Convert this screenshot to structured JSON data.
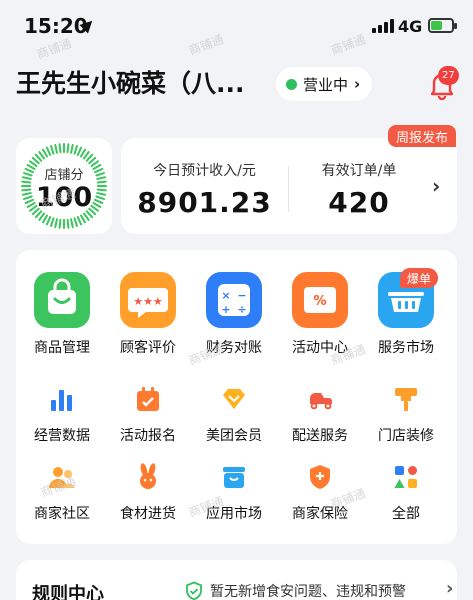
{
  "status_bar": {
    "time": "15:20",
    "network": "4G",
    "battery_level": 0.55
  },
  "header": {
    "store_name": "王先生小碗菜（八...",
    "status": "营业中",
    "notification_count": "27"
  },
  "score": {
    "label": "店铺分",
    "value": "100"
  },
  "stats": {
    "tag": "周报发布",
    "income_label": "今日预计收入/元",
    "income_value": "8901.23",
    "orders_label": "有效订单/单",
    "orders_value": "420"
  },
  "grid": {
    "hot_tag": "爆单",
    "big": [
      {
        "label": "商品管理",
        "icon": "shopping-bag-icon",
        "color": "#3cc45e"
      },
      {
        "label": "顾客评价",
        "icon": "review-stars-icon",
        "color": "#ff9f2a"
      },
      {
        "label": "财务对账",
        "icon": "calculator-icon",
        "color": "#2e7ef7"
      },
      {
        "label": "活动中心",
        "icon": "discount-ticket-icon",
        "color": "#ff7a2e"
      },
      {
        "label": "服务市场",
        "icon": "basket-icon",
        "color": "#2aa6f0"
      }
    ],
    "small": [
      {
        "label": "经营数据",
        "icon": "bar-chart-icon"
      },
      {
        "label": "活动报名",
        "icon": "calendar-icon"
      },
      {
        "label": "美团会员",
        "icon": "diamond-icon"
      },
      {
        "label": "配送服务",
        "icon": "delivery-scooter-icon"
      },
      {
        "label": "门店装修",
        "icon": "paint-roller-icon"
      },
      {
        "label": "商家社区",
        "icon": "community-icon"
      },
      {
        "label": "食材进货",
        "icon": "rabbit-icon"
      },
      {
        "label": "应用市场",
        "icon": "app-store-icon"
      },
      {
        "label": "商家保险",
        "icon": "insurance-shield-icon"
      },
      {
        "label": "全部",
        "icon": "all-apps-icon"
      }
    ]
  },
  "rules": {
    "title": "规则中心",
    "message": "暂无新增食安问题、违规和预警"
  },
  "watermark": "商铺通",
  "colors": {
    "accent_orange": "#f25a43",
    "status_green": "#2ec05e",
    "badge_red": "#f23d3d"
  }
}
